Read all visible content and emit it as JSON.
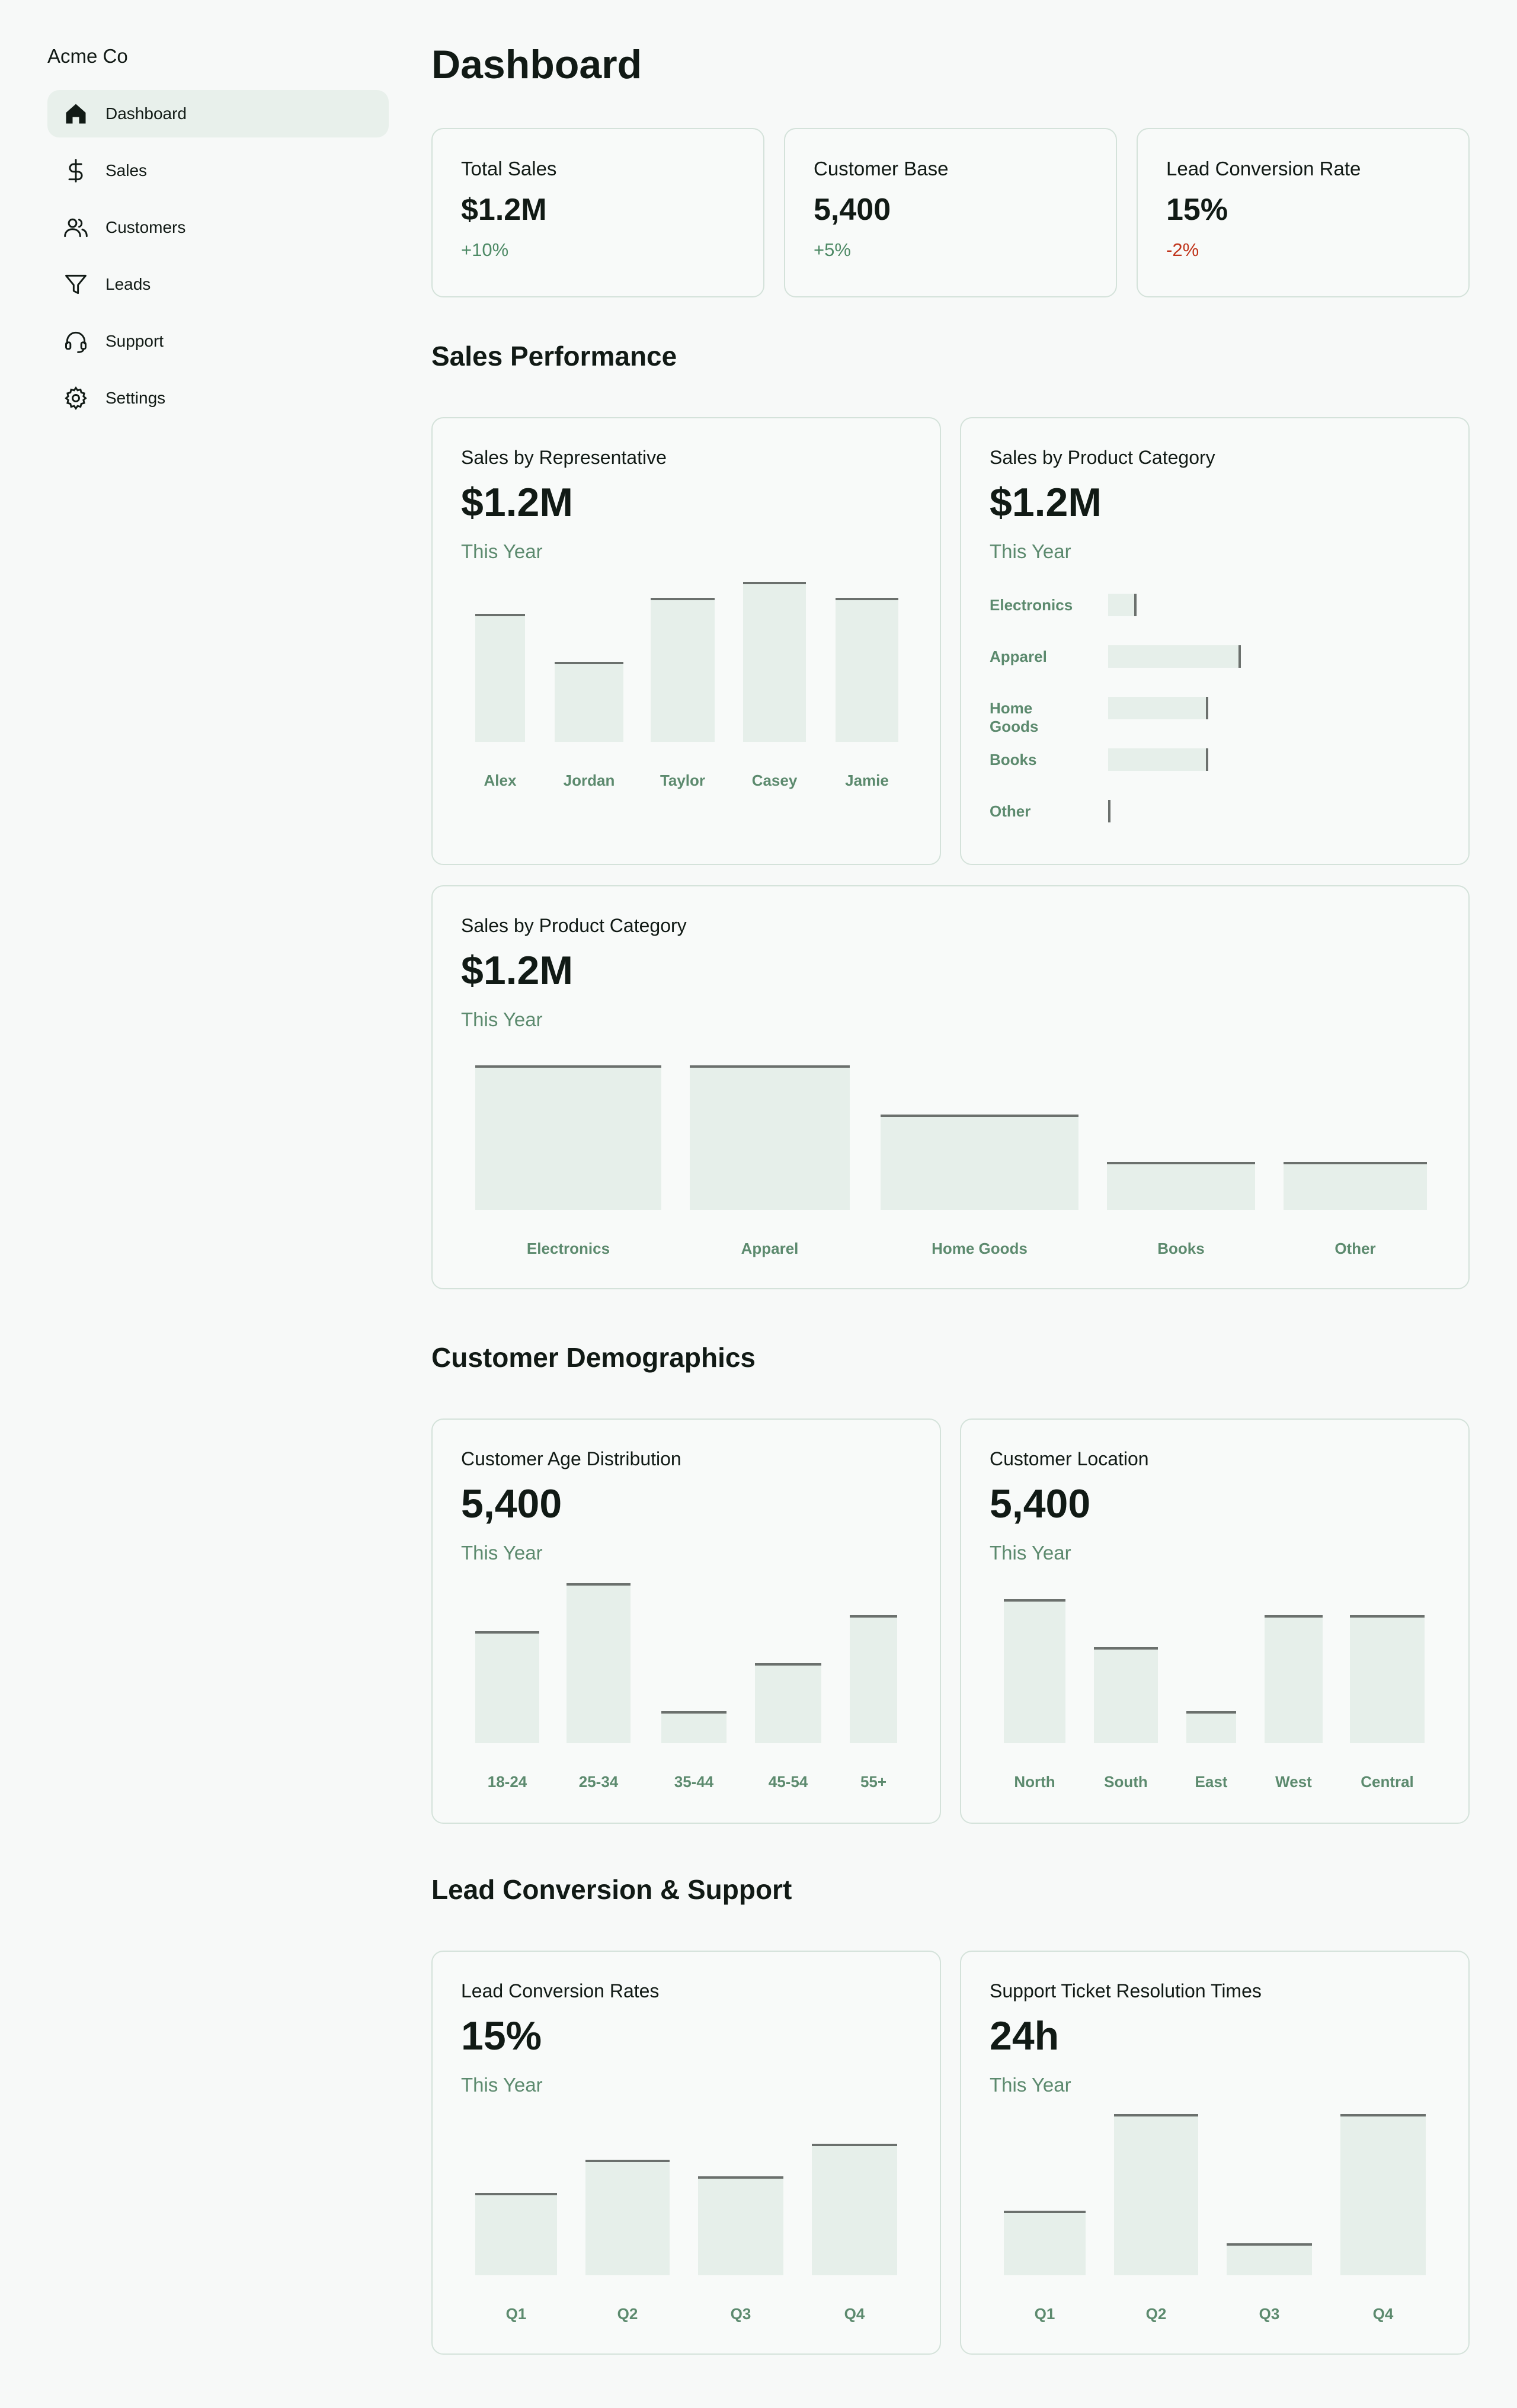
{
  "app": {
    "brand": "Acme Co"
  },
  "sidebar": {
    "items": [
      {
        "label": "Dashboard",
        "icon": "home-icon",
        "active": true
      },
      {
        "label": "Sales",
        "icon": "dollar-icon",
        "active": false
      },
      {
        "label": "Customers",
        "icon": "users-icon",
        "active": false
      },
      {
        "label": "Leads",
        "icon": "funnel-icon",
        "active": false
      },
      {
        "label": "Support",
        "icon": "headset-icon",
        "active": false
      },
      {
        "label": "Settings",
        "icon": "gear-icon",
        "active": false
      }
    ]
  },
  "page": {
    "title": "Dashboard"
  },
  "stats": [
    {
      "label": "Total Sales",
      "value": "$1.2M",
      "delta": "+10%",
      "trend": "up"
    },
    {
      "label": "Customer Base",
      "value": "5,400",
      "delta": "+5%",
      "trend": "up"
    },
    {
      "label": "Lead Conversion Rate",
      "value": "15%",
      "delta": "-2%",
      "trend": "down"
    }
  ],
  "sections": {
    "sales": "Sales Performance",
    "demographics": "Customer Demographics",
    "leads_support": "Lead Conversion & Support"
  },
  "cards": {
    "rep": {
      "title": "Sales by Representative",
      "value": "$1.2M",
      "sub": "This Year"
    },
    "category_h": {
      "title": "Sales by Product Category",
      "value": "$1.2M",
      "sub": "This Year"
    },
    "category_v": {
      "title": "Sales by Product Category",
      "value": "$1.2M",
      "sub": "This Year"
    },
    "age": {
      "title": "Customer Age Distribution",
      "value": "5,400",
      "sub": "This Year"
    },
    "location": {
      "title": "Customer Location",
      "value": "5,400",
      "sub": "This Year"
    },
    "lead_rates": {
      "title": "Lead Conversion Rates",
      "value": "15%",
      "sub": "This Year"
    },
    "support_times": {
      "title": "Support Ticket Resolution Times",
      "value": "24h",
      "sub": "This Year"
    }
  },
  "colors": {
    "background": "#f7f9f8",
    "accent_green": "#5c8a6e",
    "negative_red": "#c0341b",
    "bar_fill": "#e6efea",
    "bar_line": "#6b706d",
    "active_nav": "#e8f0eb"
  },
  "chart_data": [
    {
      "id": "rep",
      "type": "bar",
      "categories": [
        "Alex",
        "Jordan",
        "Taylor",
        "Casey",
        "Jamie"
      ],
      "values": [
        80,
        50,
        90,
        100,
        90
      ],
      "ylim": [
        0,
        100
      ]
    },
    {
      "id": "category_h",
      "type": "bar",
      "orientation": "horizontal",
      "categories": [
        "Electronics",
        "Apparel",
        "Home Goods",
        "Books",
        "Other"
      ],
      "values": [
        20,
        100,
        75,
        75,
        0
      ],
      "ylim": [
        0,
        100
      ]
    },
    {
      "id": "category_v",
      "type": "bar",
      "categories": [
        "Electronics",
        "Apparel",
        "Home Goods",
        "Books",
        "Other"
      ],
      "values": [
        100,
        100,
        66,
        33,
        33
      ],
      "ylim": [
        0,
        100
      ]
    },
    {
      "id": "age",
      "type": "bar",
      "categories": [
        "18-24",
        "25-34",
        "35-44",
        "45-54",
        "55+"
      ],
      "values": [
        70,
        100,
        20,
        50,
        80
      ],
      "ylim": [
        0,
        100
      ]
    },
    {
      "id": "location",
      "type": "bar",
      "categories": [
        "North",
        "South",
        "East",
        "West",
        "Central"
      ],
      "values": [
        90,
        60,
        20,
        80,
        80
      ],
      "ylim": [
        0,
        100
      ]
    },
    {
      "id": "lead_rates",
      "type": "bar",
      "categories": [
        "Q1",
        "Q2",
        "Q3",
        "Q4"
      ],
      "values": [
        50,
        70,
        60,
        80
      ],
      "ylim": [
        0,
        100
      ]
    },
    {
      "id": "support_times",
      "type": "bar",
      "categories": [
        "Q1",
        "Q2",
        "Q3",
        "Q4"
      ],
      "values": [
        40,
        100,
        20,
        100
      ],
      "ylim": [
        0,
        100
      ]
    }
  ]
}
